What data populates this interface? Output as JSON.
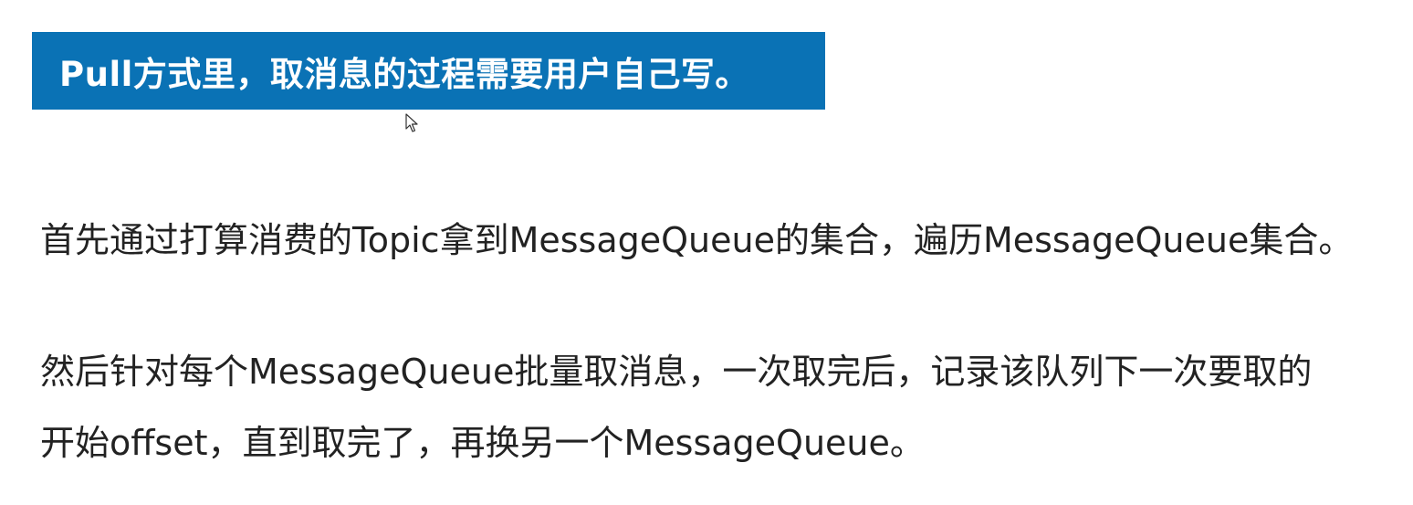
{
  "banner": {
    "title": "Pull方式里，取消息的过程需要用户自己写。"
  },
  "content": {
    "paragraph_1": "首先通过打算消费的Topic拿到MessageQueue的集合，遍历MessageQueue集合。",
    "paragraph_2_line_1": "然后针对每个MessageQueue批量取消息，一次取完后，记录该队列下一次要取的",
    "paragraph_2_line_2": "开始offset，直到取完了，再换另一个MessageQueue。"
  },
  "cursor": {
    "icon": "mouse-pointer-icon"
  },
  "colors": {
    "banner_bg": "#0a72b5",
    "banner_text": "#ffffff",
    "body_text": "#222222",
    "background": "#ffffff"
  }
}
